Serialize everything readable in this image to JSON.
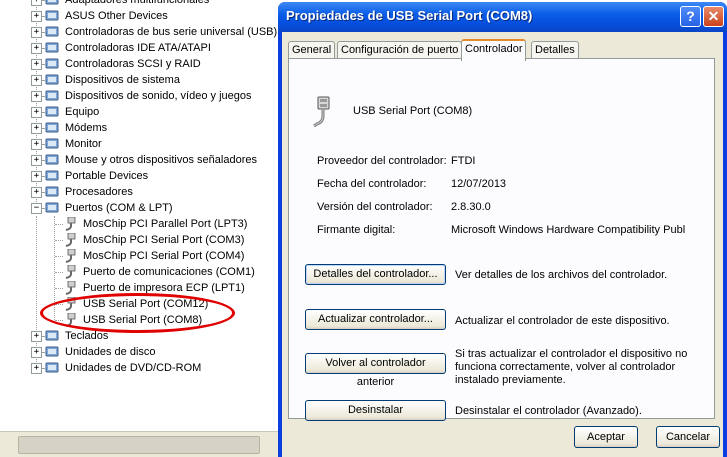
{
  "tree": {
    "items": [
      {
        "label": "Adaptadores multifuncionales",
        "icon": "multifunction-icon",
        "expander": "+"
      },
      {
        "label": "ASUS Other Devices",
        "icon": "device-icon",
        "expander": "+"
      },
      {
        "label": "Controladoras de bus serie universal (USB)",
        "icon": "usb-controller-icon",
        "expander": "+"
      },
      {
        "label": "Controladoras IDE ATA/ATAPI",
        "icon": "ide-controller-icon",
        "expander": "+"
      },
      {
        "label": "Controladoras SCSI y RAID",
        "icon": "scsi-controller-icon",
        "expander": "+"
      },
      {
        "label": "Dispositivos de sistema",
        "icon": "system-device-icon",
        "expander": "+"
      },
      {
        "label": "Dispositivos de sonido, vídeo y juegos",
        "icon": "sound-icon",
        "expander": "+"
      },
      {
        "label": "Equipo",
        "icon": "computer-icon",
        "expander": "+"
      },
      {
        "label": "Módems",
        "icon": "modem-icon",
        "expander": "+"
      },
      {
        "label": "Monitor",
        "icon": "monitor-icon",
        "expander": "+"
      },
      {
        "label": "Mouse y otros dispositivos señaladores",
        "icon": "mouse-icon",
        "expander": "+"
      },
      {
        "label": "Portable Devices",
        "icon": "portable-device-icon",
        "expander": "+"
      },
      {
        "label": "Procesadores",
        "icon": "processor-icon",
        "expander": "+"
      },
      {
        "label": "Puertos (COM & LPT)",
        "icon": "port-icon",
        "expander": "−"
      }
    ],
    "ports": [
      "MosChip PCI Parallel Port (LPT3)",
      "MosChip PCI Serial Port (COM3)",
      "MosChip PCI Serial Port (COM4)",
      "Puerto de comunicaciones (COM1)",
      "Puerto de impresora ECP (LPT1)",
      "USB Serial Port (COM12)",
      "USB Serial Port (COM8)"
    ],
    "after": [
      {
        "label": "Teclados",
        "icon": "keyboard-icon",
        "expander": "+"
      },
      {
        "label": "Unidades de disco",
        "icon": "disk-icon",
        "expander": "+"
      },
      {
        "label": "Unidades de DVD/CD-ROM",
        "icon": "dvd-icon",
        "expander": "+"
      }
    ]
  },
  "dialog": {
    "title": "Propiedades de USB Serial Port (COM8)",
    "help_glyph": "?",
    "close_glyph": "✕",
    "tabs": [
      "General",
      "Configuración de puerto",
      "Controlador",
      "Detalles"
    ],
    "active_tab": "Controlador",
    "device_name": "USB Serial Port (COM8)",
    "fields": [
      {
        "label": "Proveedor del controlador:",
        "value": "FTDI"
      },
      {
        "label": "Fecha del controlador:",
        "value": "12/07/2013"
      },
      {
        "label": "Versión del controlador:",
        "value": "2.8.30.0"
      },
      {
        "label": "Firmante digital:",
        "value": "Microsoft Windows Hardware Compatibility Publ"
      }
    ],
    "actions": [
      {
        "button": "Detalles del controlador...",
        "description": "Ver detalles de los archivos del controlador."
      },
      {
        "button": "Actualizar controlador...",
        "description": "Actualizar el controlador de este dispositivo."
      },
      {
        "button": "Volver al controlador anterior",
        "description": "Si tras actualizar el controlador el dispositivo no funciona correctamente, volver al controlador instalado previamente."
      },
      {
        "button": "Desinstalar",
        "description": "Desinstalar el controlador (Avanzado)."
      }
    ],
    "ok_label": "Aceptar",
    "cancel_label": "Cancelar"
  },
  "colors": {
    "titlebar": "#0b5ee8",
    "highlight_ellipse": "#e00000",
    "active_tab_accent": "#e68b2c"
  }
}
